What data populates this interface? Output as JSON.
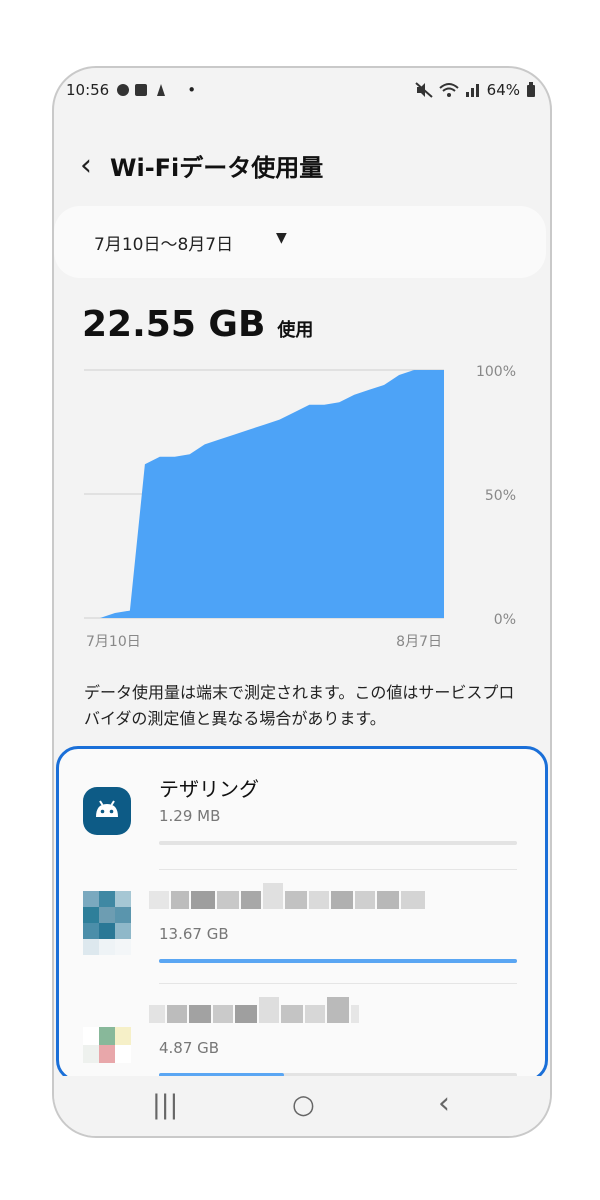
{
  "status": {
    "time": "10:56",
    "dot": "•",
    "battery": "64%"
  },
  "header": {
    "back_icon": "‹",
    "title": "Wi-Fiデータ使用量"
  },
  "date_range": {
    "label": "7月10日〜8月7日",
    "caret": "▼"
  },
  "usage": {
    "amount": "22.55 GB",
    "suffix": "使用"
  },
  "chart_data": {
    "type": "area",
    "x_labels": [
      "7月10日",
      "8月7日"
    ],
    "y_ticks": [
      "100%",
      "50%",
      "0%"
    ],
    "ylim": [
      0,
      100
    ],
    "values": [
      0,
      2,
      3,
      62,
      65,
      65,
      66,
      70,
      72,
      74,
      76,
      78,
      80,
      83,
      86,
      86,
      87,
      90,
      92,
      94,
      98,
      100,
      100,
      100
    ],
    "color": "#4da3f7"
  },
  "note": "データ使用量は端末で測定されます。この値はサービスプロバイダの測定値と異なる場合があります。",
  "apps": [
    {
      "name": "テザリング",
      "size": "1.29 MB",
      "fraction": 0.0
    },
    {
      "name": "",
      "size": "13.67 GB",
      "fraction": 1.0
    },
    {
      "name": "",
      "size": "4.87 GB",
      "fraction": 0.35
    }
  ],
  "nav": {
    "recents": "|||",
    "home": "○",
    "back": "‹"
  }
}
